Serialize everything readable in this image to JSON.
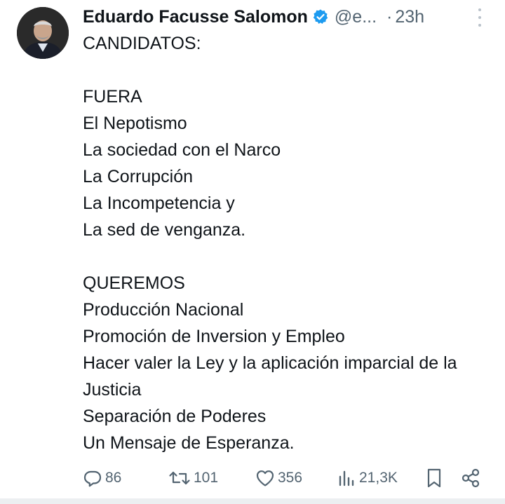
{
  "tweet": {
    "author_name": "Eduardo Facusse Salomon",
    "handle": "@e...",
    "separator": "·",
    "time": "23h",
    "lines": [
      "CANDIDATOS:",
      "",
      "FUERA",
      "El Nepotismo",
      "La sociedad con el Narco",
      "La Corrupción",
      "La Incompetencia y",
      "La sed de venganza.",
      "",
      "QUEREMOS",
      "Producción Nacional",
      "Promoción de Inversion y Empleo",
      "Hacer valer la Ley y la aplicación imparcial de la Justicia",
      "Separación de Poderes",
      "Un Mensaje de Esperanza."
    ]
  },
  "actions": {
    "replies": "86",
    "retweets": "101",
    "likes": "356",
    "views": "21,3K"
  },
  "icons": {
    "verified": "verified-badge-icon",
    "more": "more-vertical-icon",
    "reply": "reply-icon",
    "retweet": "retweet-icon",
    "like": "heart-icon",
    "views": "views-icon",
    "bookmark": "bookmark-icon",
    "share": "share-icon"
  },
  "colors": {
    "text": "#0f1419",
    "muted": "#536471",
    "verified": "#1d9bf0"
  }
}
